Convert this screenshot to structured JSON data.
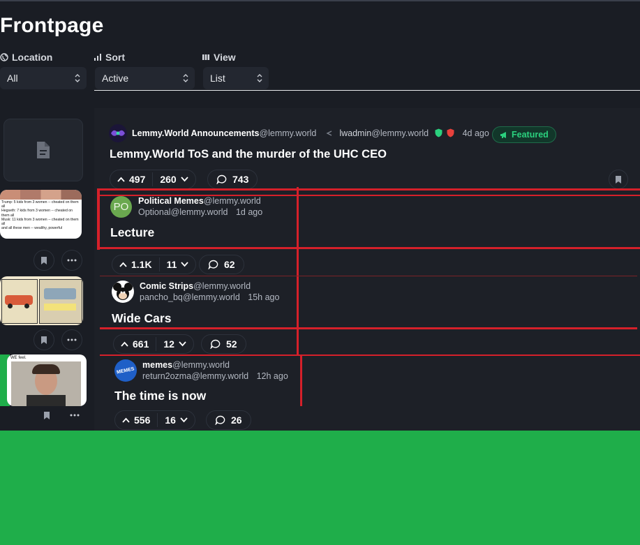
{
  "page": {
    "title": "Frontpage"
  },
  "filters": {
    "location": {
      "label": "Location",
      "value": "All"
    },
    "sort": {
      "label": "Sort",
      "value": "Active"
    },
    "view": {
      "label": "View",
      "value": "List"
    }
  },
  "posts": [
    {
      "community": "Lemmy.World Announcements",
      "community_instance": "@lemmy.world",
      "author": "lwadmin",
      "author_instance": "@lemmy.world",
      "age": "4d ago",
      "badge": "Featured",
      "title": "Lemmy.World ToS and the murder of the UHC CEO",
      "upvotes": "497",
      "downvotes": "260",
      "comments": "743"
    },
    {
      "community": "Political Memes",
      "community_instance": "@lemmy.world",
      "author": "Optional",
      "author_instance": "@lemmy.world",
      "age": "1d ago",
      "avatar_text": "PO",
      "title": "Lecture",
      "upvotes": "1.1K",
      "downvotes": "11",
      "comments": "62"
    },
    {
      "community": "Comic Strips",
      "community_instance": "@lemmy.world",
      "author": "pancho_bq",
      "author_instance": "@lemmy.world",
      "age": "15h ago",
      "title": "Wide Cars",
      "upvotes": "661",
      "downvotes": "12",
      "comments": "52"
    },
    {
      "community": "memes",
      "community_instance": "@lemmy.world",
      "author": "return2ozma",
      "author_instance": "@lemmy.world",
      "age": "12h ago",
      "avatar_text": "MEMES",
      "title": "The time is now",
      "upvotes": "556",
      "downvotes": "16",
      "comments": "26"
    }
  ],
  "thumbnails": {
    "political_lines": [
      "Trump: 5 kids from 3 women -- cheated on them all",
      "Hegseth: 7 kids from 3 women -- cheated on them all",
      "Musk: 11 kids from 3 women -- cheated on them all",
      "and all these men -- wealthy, powerful"
    ],
    "memes_caption": "WE feel."
  },
  "colors": {
    "background": "#1a1d24",
    "outer": "#1fae4a",
    "accent_red": "#d5202a",
    "featured_green": "#2bd17e"
  }
}
